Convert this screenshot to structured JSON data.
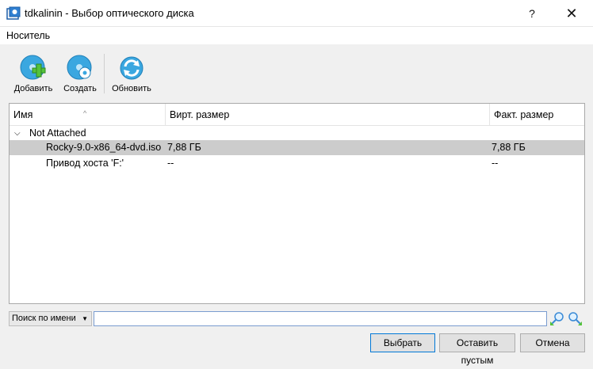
{
  "window": {
    "title": "tdkalinin - Выбор оптического диска",
    "help_label": "?",
    "close_label": "✕"
  },
  "menu": {
    "items": [
      {
        "label": "Носитель"
      }
    ]
  },
  "toolbar": {
    "add_label": "Добавить",
    "create_label": "Создать",
    "refresh_label": "Обновить"
  },
  "tree": {
    "columns": [
      "Имя",
      "Вирт. размер",
      "Факт. размер"
    ],
    "sort_indicator": "^",
    "group": {
      "label": "Not Attached",
      "expanded": true
    },
    "rows": [
      {
        "name": "Rocky-9.0-x86_64-dvd.iso",
        "virtual_size": "7,88 ГБ",
        "actual_size": "7,88 ГБ",
        "selected": true
      },
      {
        "name": "Привод хоста 'F:'",
        "virtual_size": "--",
        "actual_size": "--",
        "selected": false
      }
    ]
  },
  "filter": {
    "mode_selected": "Поиск по имени",
    "value": ""
  },
  "buttons": {
    "choose_label": "Выбрать",
    "leave_empty_label": "Оставить пустым",
    "cancel_label": "Отмена"
  },
  "colors": {
    "selected_row": "#cccccc",
    "default_button_border": "#0078d7",
    "icon_blue": "#3aa7e0",
    "icon_green": "#55c23b"
  }
}
